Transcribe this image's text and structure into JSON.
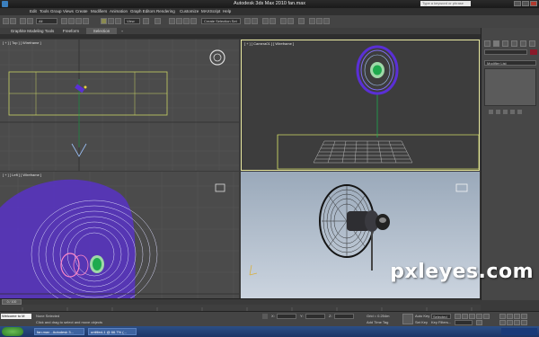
{
  "window": {
    "title": "Autodesk 3ds Max  2010    fan.max",
    "search_placeholder": "Type a keyword or phrase"
  },
  "menu": [
    "Edit",
    "Tools",
    "Group",
    "Views",
    "Create",
    "Modifiers",
    "Animation",
    "Graph Editors",
    "Rendering",
    "Customize",
    "MAXScript",
    "Help"
  ],
  "toolbar": {
    "selection_filter": "All",
    "ref_coord": "View",
    "named_selection": "Create Selection Set"
  },
  "ribbon": {
    "tabs": [
      "Graphite Modeling Tools",
      "Freeform",
      "Selection"
    ],
    "active_tab": "Selection"
  },
  "viewports": {
    "top": "[ + ] [ Top ] [ Wireframe ]",
    "camera": "[ + ] [ Camera01 ] [ Wireframe ]",
    "left": "[ + ] [ Left ] [ Wireframe ]",
    "perspective": ""
  },
  "command_panel": {
    "modifier_list": "Modifier List"
  },
  "timeline": {
    "frame": "0 / 100"
  },
  "status": {
    "maxscript": "Welcome to M",
    "selection": "None Selected",
    "prompt": "Click and drag to select and move objects",
    "x": "X:",
    "y": "Y:",
    "z": "Z:",
    "grid": "Grid = 0.254m",
    "add_time_tag": "Add Time Tag",
    "autokey": "Auto Key",
    "setkey": "Set Key",
    "selected": "Selected",
    "key_filters": "Key Filters..."
  },
  "taskbar": {
    "tasks": [
      "fan.max - Autodesk 3...",
      "untitled-1 @ 66.7% (..."
    ]
  },
  "watermark": "pxleyes.com",
  "colors": {
    "wire_fan_left": "#5a2fd6",
    "wire_fan_camera": "#5a2fd6",
    "motor_green": "#1faa4e",
    "grid_yellow": "#c8d264",
    "swatch": "#8b1a2a"
  }
}
